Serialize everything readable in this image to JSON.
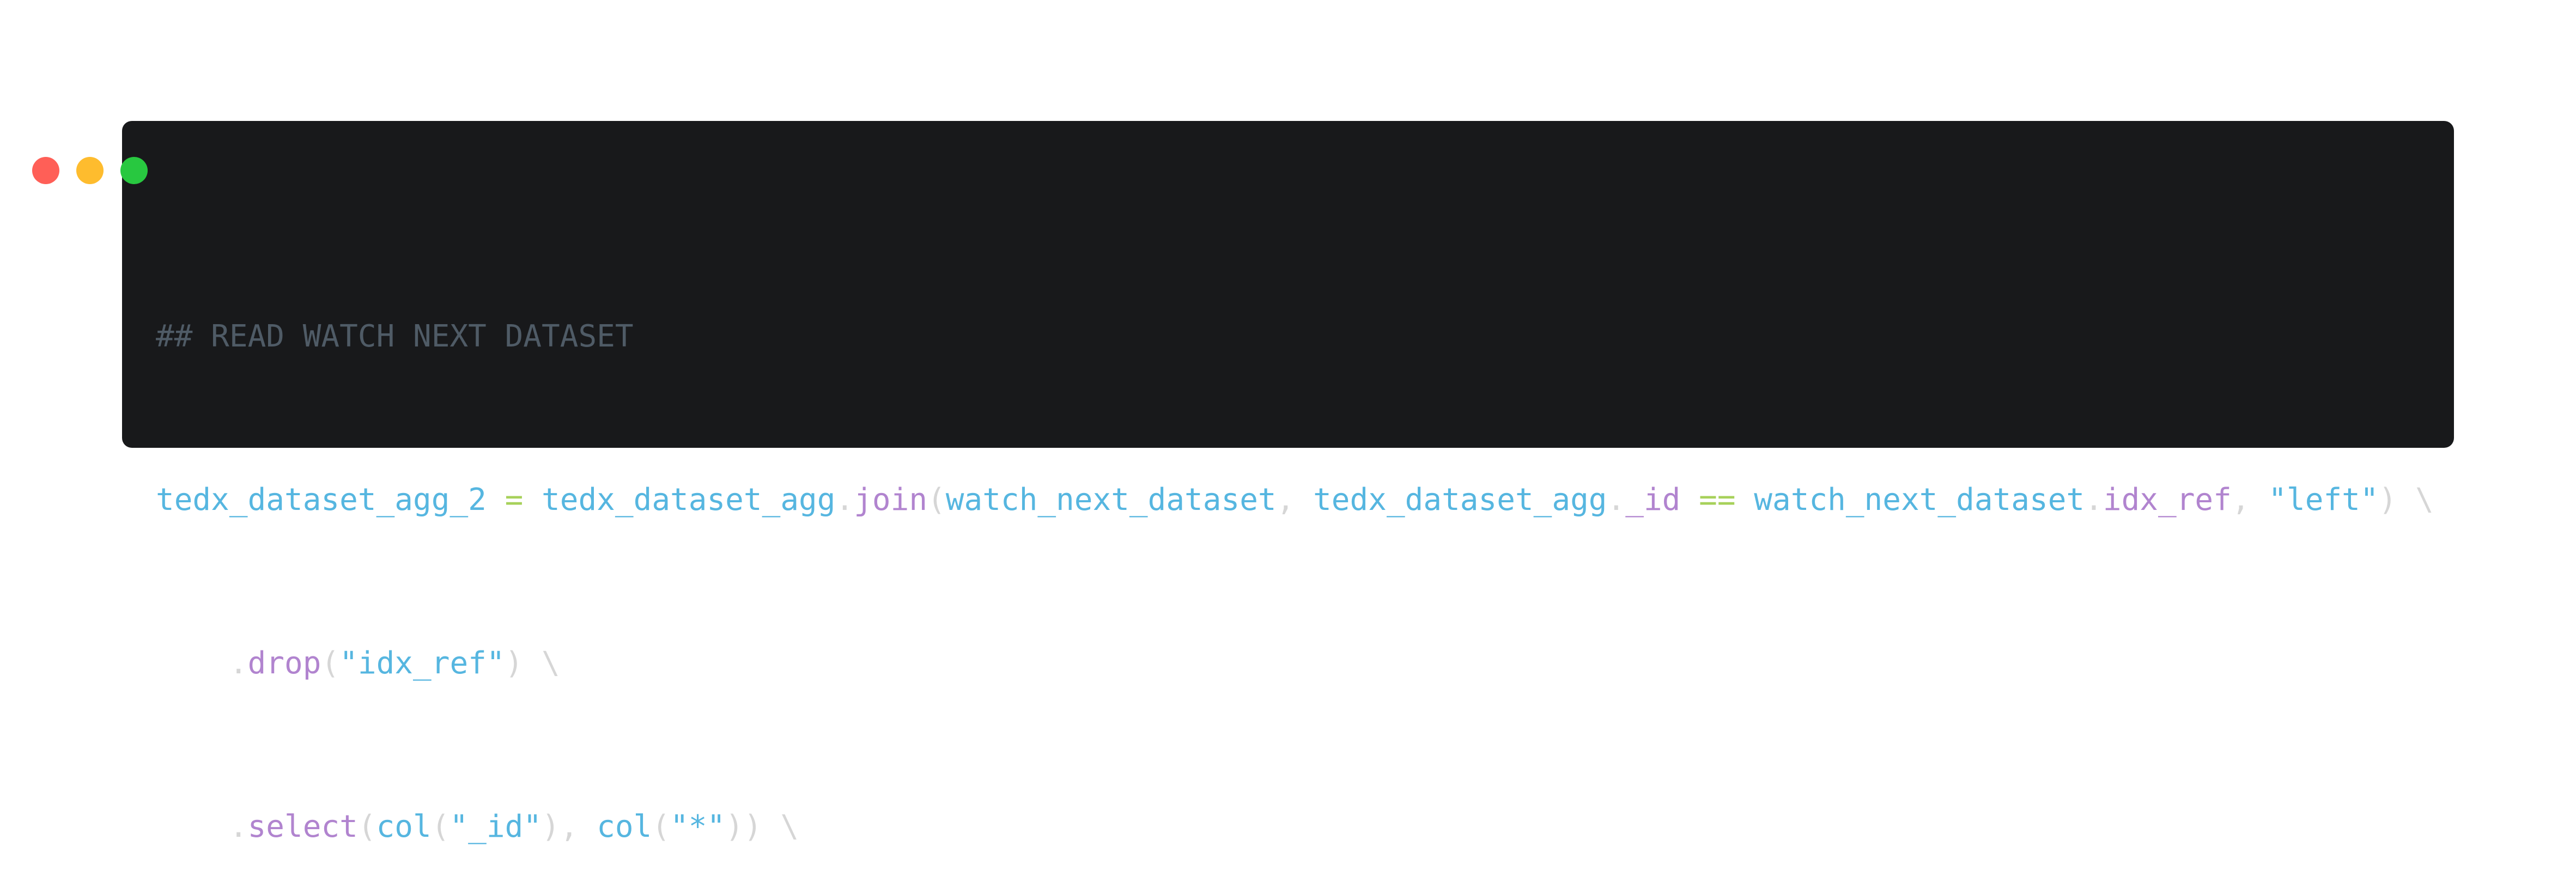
{
  "window": {
    "controls": [
      "close",
      "minimize",
      "maximize"
    ]
  },
  "code": {
    "line1": {
      "comment": "## READ WATCH NEXT DATASET"
    },
    "line2": {
      "var_assign": "tedx_dataset_agg_2",
      "op_assign": " = ",
      "left_df": "tedx_dataset_agg",
      "dot1": ".",
      "method_join": "join",
      "paren_open": "(",
      "arg_df": "watch_next_dataset",
      "comma1": ", ",
      "left_df2": "tedx_dataset_agg",
      "dot2": ".",
      "field_id": "_id",
      "space1": " ",
      "op_eq": "==",
      "space2": " ",
      "right_df": "watch_next_dataset",
      "dot3": ".",
      "field_idx": "idx_ref",
      "comma2": ", ",
      "str_left": "\"left\"",
      "paren_close": ")",
      "continuation": " \\"
    },
    "line3": {
      "indent": "    ",
      "dot": ".",
      "method_drop": "drop",
      "paren_open": "(",
      "str_arg": "\"idx_ref\"",
      "paren_close": ")",
      "continuation": " \\"
    },
    "line4": {
      "indent": "    ",
      "dot": ".",
      "method_select": "select",
      "paren_open": "(",
      "col_fn1": "col",
      "paren_open2": "(",
      "str_id": "\"_id\"",
      "paren_close2": ")",
      "comma": ", ",
      "col_fn2": "col",
      "paren_open3": "(",
      "str_star": "\"*\"",
      "paren_close3": "))",
      "continuation": " \\"
    }
  }
}
